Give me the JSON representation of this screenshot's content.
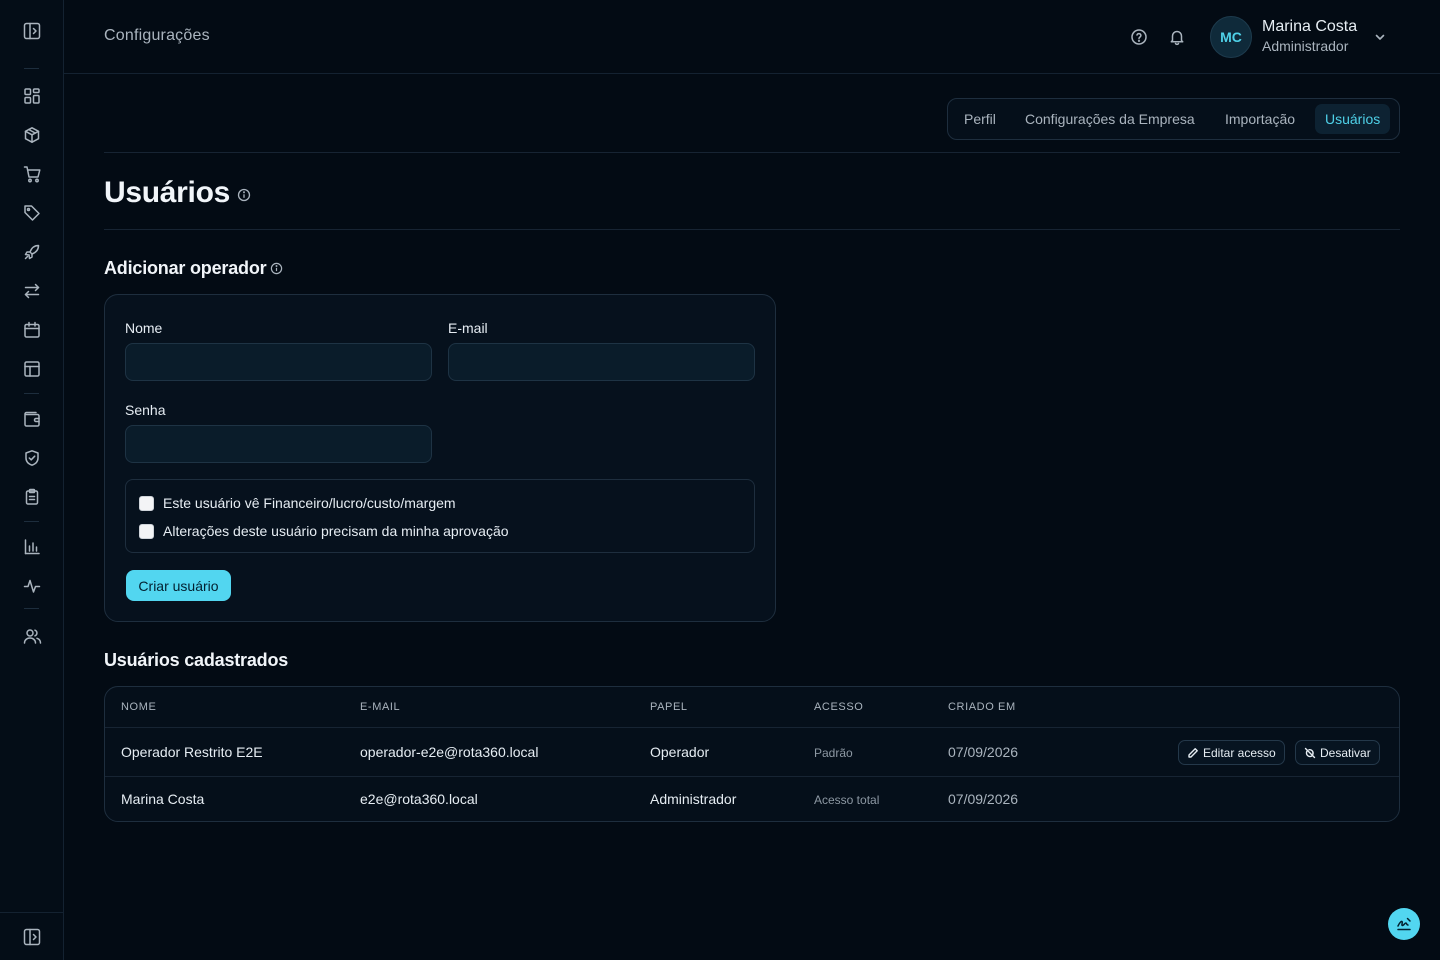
{
  "header": {
    "title": "Configurações",
    "user": {
      "initials": "MC",
      "name": "Marina Costa",
      "role": "Administrador"
    }
  },
  "tabs": [
    {
      "label": "Perfil",
      "active": false
    },
    {
      "label": "Configurações da Empresa",
      "active": false
    },
    {
      "label": "Importação",
      "active": false
    },
    {
      "label": "Usuários",
      "active": true
    }
  ],
  "page": {
    "title": "Usuários"
  },
  "add_operator": {
    "title": "Adicionar operador",
    "fields": {
      "name": {
        "label": "Nome",
        "value": "",
        "placeholder": ""
      },
      "email": {
        "label": "E-mail",
        "value": "",
        "placeholder": ""
      },
      "password": {
        "label": "Senha",
        "value": "",
        "placeholder": ""
      }
    },
    "checkboxes": [
      {
        "label": "Este usuário vê Financeiro/lucro/custo/margem",
        "checked": false
      },
      {
        "label": "Alterações deste usuário precisam da minha aprovação",
        "checked": false
      }
    ],
    "submit_label": "Criar usuário"
  },
  "users_table": {
    "title": "Usuários cadastrados",
    "columns": [
      "NOME",
      "E-MAIL",
      "PAPEL",
      "ACESSO",
      "CRIADO EM"
    ],
    "rows": [
      {
        "name": "Operador Restrito E2E",
        "email": "operador-e2e@rota360.local",
        "role": "Operador",
        "access": "Padrão",
        "created": "07/09/2026",
        "actions": {
          "edit": "Editar acesso",
          "deactivate": "Desativar"
        }
      },
      {
        "name": "Marina Costa",
        "email": "e2e@rota360.local",
        "role": "Administrador",
        "access": "Acesso total",
        "created": "07/09/2026"
      }
    ]
  },
  "sidebar": {
    "icons": [
      "panel-toggle-icon",
      "dashboard-icon",
      "box-icon",
      "cart-icon",
      "tag-icon",
      "rocket-icon",
      "transfer-icon",
      "calendar-icon",
      "layout-icon",
      "wallet-icon",
      "shield-check-icon",
      "clipboard-icon",
      "bar-chart-icon",
      "activity-icon",
      "users-icon",
      "panel-toggle-icon"
    ]
  },
  "colors": {
    "background": "#030b14",
    "accent": "#52d6f0",
    "border": "#1e2e3e",
    "text": "#e6edf3",
    "muted": "#aab4be"
  }
}
